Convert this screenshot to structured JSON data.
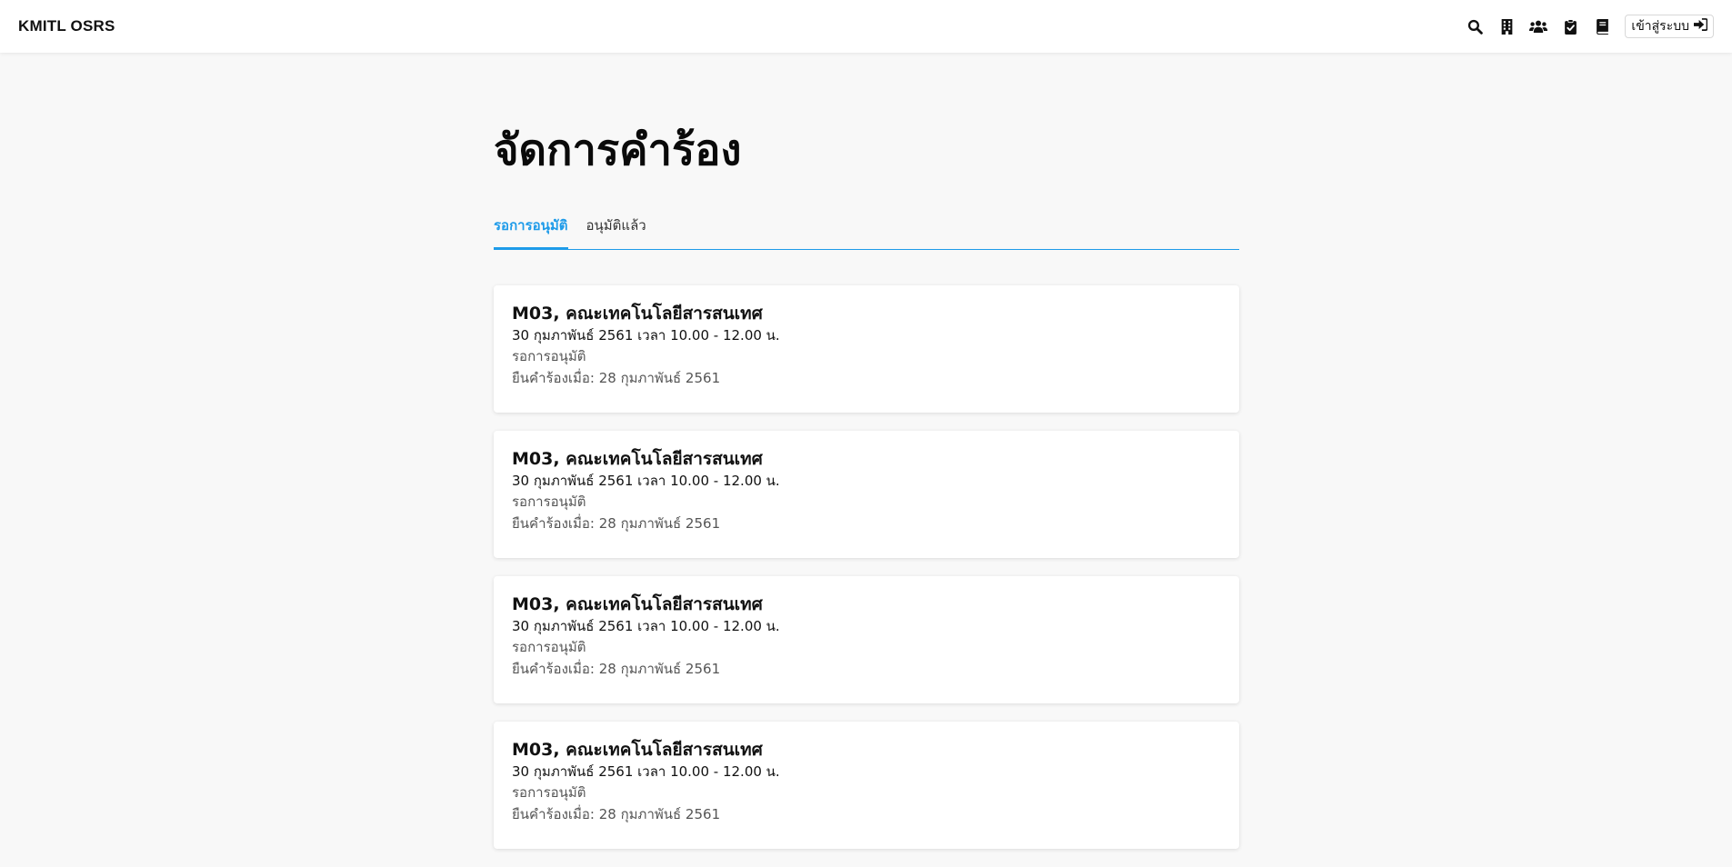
{
  "navbar": {
    "brand": "KMITL OSRS",
    "icons": [
      "search-icon",
      "building-icon",
      "users-icon",
      "clipboard-check-icon",
      "book-icon"
    ],
    "login_label": "เข้าสู่ระบบ"
  },
  "page": {
    "title": "จัดการคำร้อง"
  },
  "tabs": [
    {
      "label": "รอการอนุมัติ",
      "active": true
    },
    {
      "label": "อนุมัติแล้ว",
      "active": false
    }
  ],
  "requests": [
    {
      "title": "M03, คณะเทคโนโลยีสารสนเทศ",
      "time": "30 กุมภาพันธ์ 2561 เวลา 10.00 - 12.00 น.",
      "status": "รอการอนุมัติ",
      "submitted": "ยืนคำร้องเมื่อ: 28 กุมภาพันธ์ 2561"
    },
    {
      "title": "M03, คณะเทคโนโลยีสารสนเทศ",
      "time": "30 กุมภาพันธ์ 2561 เวลา 10.00 - 12.00 น.",
      "status": "รอการอนุมัติ",
      "submitted": "ยืนคำร้องเมื่อ: 28 กุมภาพันธ์ 2561"
    },
    {
      "title": "M03, คณะเทคโนโลยีสารสนเทศ",
      "time": "30 กุมภาพันธ์ 2561 เวลา 10.00 - 12.00 น.",
      "status": "รอการอนุมัติ",
      "submitted": "ยืนคำร้องเมื่อ: 28 กุมภาพันธ์ 2561"
    },
    {
      "title": "M03, คณะเทคโนโลยีสารสนเทศ",
      "time": "30 กุมภาพันธ์ 2561 เวลา 10.00 - 12.00 น.",
      "status": "รอการอนุมัติ",
      "submitted": "ยืนคำร้องเมื่อ: 28 กุมภาพันธ์ 2561"
    }
  ],
  "colors": {
    "accent": "#1e9be9",
    "background": "#f8f8f8",
    "card": "#ffffff"
  }
}
